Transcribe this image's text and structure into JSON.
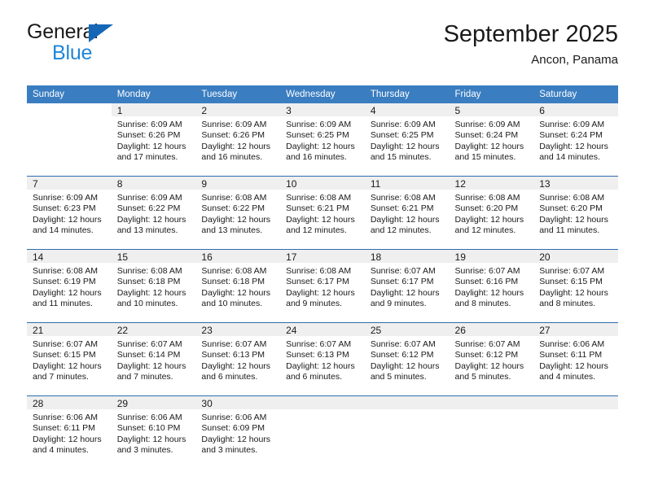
{
  "brand": {
    "name_part1": "General",
    "name_part2": "Blue",
    "triangle_color": "#1567b5",
    "blue_text_color": "#1f86d8"
  },
  "header": {
    "title": "September 2025",
    "subtitle": "Ancon, Panama",
    "header_bg_color": "#3a7dc0",
    "row_divider_color": "#2e6daf",
    "daynum_band_color": "#efefef"
  },
  "weekday_headers": [
    "Sunday",
    "Monday",
    "Tuesday",
    "Wednesday",
    "Thursday",
    "Friday",
    "Saturday"
  ],
  "labels": {
    "sunrise_prefix": "Sunrise:",
    "sunset_prefix": "Sunset:",
    "daylight_prefix": "Daylight:"
  },
  "weeks": [
    [
      {
        "day": "",
        "blank": true
      },
      {
        "day": "1",
        "sunrise": "Sunrise: 6:09 AM",
        "sunset": "Sunset: 6:26 PM",
        "daylight": "Daylight: 12 hours and 17 minutes."
      },
      {
        "day": "2",
        "sunrise": "Sunrise: 6:09 AM",
        "sunset": "Sunset: 6:26 PM",
        "daylight": "Daylight: 12 hours and 16 minutes."
      },
      {
        "day": "3",
        "sunrise": "Sunrise: 6:09 AM",
        "sunset": "Sunset: 6:25 PM",
        "daylight": "Daylight: 12 hours and 16 minutes."
      },
      {
        "day": "4",
        "sunrise": "Sunrise: 6:09 AM",
        "sunset": "Sunset: 6:25 PM",
        "daylight": "Daylight: 12 hours and 15 minutes."
      },
      {
        "day": "5",
        "sunrise": "Sunrise: 6:09 AM",
        "sunset": "Sunset: 6:24 PM",
        "daylight": "Daylight: 12 hours and 15 minutes."
      },
      {
        "day": "6",
        "sunrise": "Sunrise: 6:09 AM",
        "sunset": "Sunset: 6:24 PM",
        "daylight": "Daylight: 12 hours and 14 minutes."
      }
    ],
    [
      {
        "day": "7",
        "sunrise": "Sunrise: 6:09 AM",
        "sunset": "Sunset: 6:23 PM",
        "daylight": "Daylight: 12 hours and 14 minutes."
      },
      {
        "day": "8",
        "sunrise": "Sunrise: 6:09 AM",
        "sunset": "Sunset: 6:22 PM",
        "daylight": "Daylight: 12 hours and 13 minutes."
      },
      {
        "day": "9",
        "sunrise": "Sunrise: 6:08 AM",
        "sunset": "Sunset: 6:22 PM",
        "daylight": "Daylight: 12 hours and 13 minutes."
      },
      {
        "day": "10",
        "sunrise": "Sunrise: 6:08 AM",
        "sunset": "Sunset: 6:21 PM",
        "daylight": "Daylight: 12 hours and 12 minutes."
      },
      {
        "day": "11",
        "sunrise": "Sunrise: 6:08 AM",
        "sunset": "Sunset: 6:21 PM",
        "daylight": "Daylight: 12 hours and 12 minutes."
      },
      {
        "day": "12",
        "sunrise": "Sunrise: 6:08 AM",
        "sunset": "Sunset: 6:20 PM",
        "daylight": "Daylight: 12 hours and 12 minutes."
      },
      {
        "day": "13",
        "sunrise": "Sunrise: 6:08 AM",
        "sunset": "Sunset: 6:20 PM",
        "daylight": "Daylight: 12 hours and 11 minutes."
      }
    ],
    [
      {
        "day": "14",
        "sunrise": "Sunrise: 6:08 AM",
        "sunset": "Sunset: 6:19 PM",
        "daylight": "Daylight: 12 hours and 11 minutes."
      },
      {
        "day": "15",
        "sunrise": "Sunrise: 6:08 AM",
        "sunset": "Sunset: 6:18 PM",
        "daylight": "Daylight: 12 hours and 10 minutes."
      },
      {
        "day": "16",
        "sunrise": "Sunrise: 6:08 AM",
        "sunset": "Sunset: 6:18 PM",
        "daylight": "Daylight: 12 hours and 10 minutes."
      },
      {
        "day": "17",
        "sunrise": "Sunrise: 6:08 AM",
        "sunset": "Sunset: 6:17 PM",
        "daylight": "Daylight: 12 hours and 9 minutes."
      },
      {
        "day": "18",
        "sunrise": "Sunrise: 6:07 AM",
        "sunset": "Sunset: 6:17 PM",
        "daylight": "Daylight: 12 hours and 9 minutes."
      },
      {
        "day": "19",
        "sunrise": "Sunrise: 6:07 AM",
        "sunset": "Sunset: 6:16 PM",
        "daylight": "Daylight: 12 hours and 8 minutes."
      },
      {
        "day": "20",
        "sunrise": "Sunrise: 6:07 AM",
        "sunset": "Sunset: 6:15 PM",
        "daylight": "Daylight: 12 hours and 8 minutes."
      }
    ],
    [
      {
        "day": "21",
        "sunrise": "Sunrise: 6:07 AM",
        "sunset": "Sunset: 6:15 PM",
        "daylight": "Daylight: 12 hours and 7 minutes."
      },
      {
        "day": "22",
        "sunrise": "Sunrise: 6:07 AM",
        "sunset": "Sunset: 6:14 PM",
        "daylight": "Daylight: 12 hours and 7 minutes."
      },
      {
        "day": "23",
        "sunrise": "Sunrise: 6:07 AM",
        "sunset": "Sunset: 6:13 PM",
        "daylight": "Daylight: 12 hours and 6 minutes."
      },
      {
        "day": "24",
        "sunrise": "Sunrise: 6:07 AM",
        "sunset": "Sunset: 6:13 PM",
        "daylight": "Daylight: 12 hours and 6 minutes."
      },
      {
        "day": "25",
        "sunrise": "Sunrise: 6:07 AM",
        "sunset": "Sunset: 6:12 PM",
        "daylight": "Daylight: 12 hours and 5 minutes."
      },
      {
        "day": "26",
        "sunrise": "Sunrise: 6:07 AM",
        "sunset": "Sunset: 6:12 PM",
        "daylight": "Daylight: 12 hours and 5 minutes."
      },
      {
        "day": "27",
        "sunrise": "Sunrise: 6:06 AM",
        "sunset": "Sunset: 6:11 PM",
        "daylight": "Daylight: 12 hours and 4 minutes."
      }
    ],
    [
      {
        "day": "28",
        "sunrise": "Sunrise: 6:06 AM",
        "sunset": "Sunset: 6:11 PM",
        "daylight": "Daylight: 12 hours and 4 minutes."
      },
      {
        "day": "29",
        "sunrise": "Sunrise: 6:06 AM",
        "sunset": "Sunset: 6:10 PM",
        "daylight": "Daylight: 12 hours and 3 minutes."
      },
      {
        "day": "30",
        "sunrise": "Sunrise: 6:06 AM",
        "sunset": "Sunset: 6:09 PM",
        "daylight": "Daylight: 12 hours and 3 minutes."
      },
      {
        "day": "",
        "blank": true
      },
      {
        "day": "",
        "blank": true
      },
      {
        "day": "",
        "blank": true
      },
      {
        "day": "",
        "blank": true
      }
    ]
  ]
}
